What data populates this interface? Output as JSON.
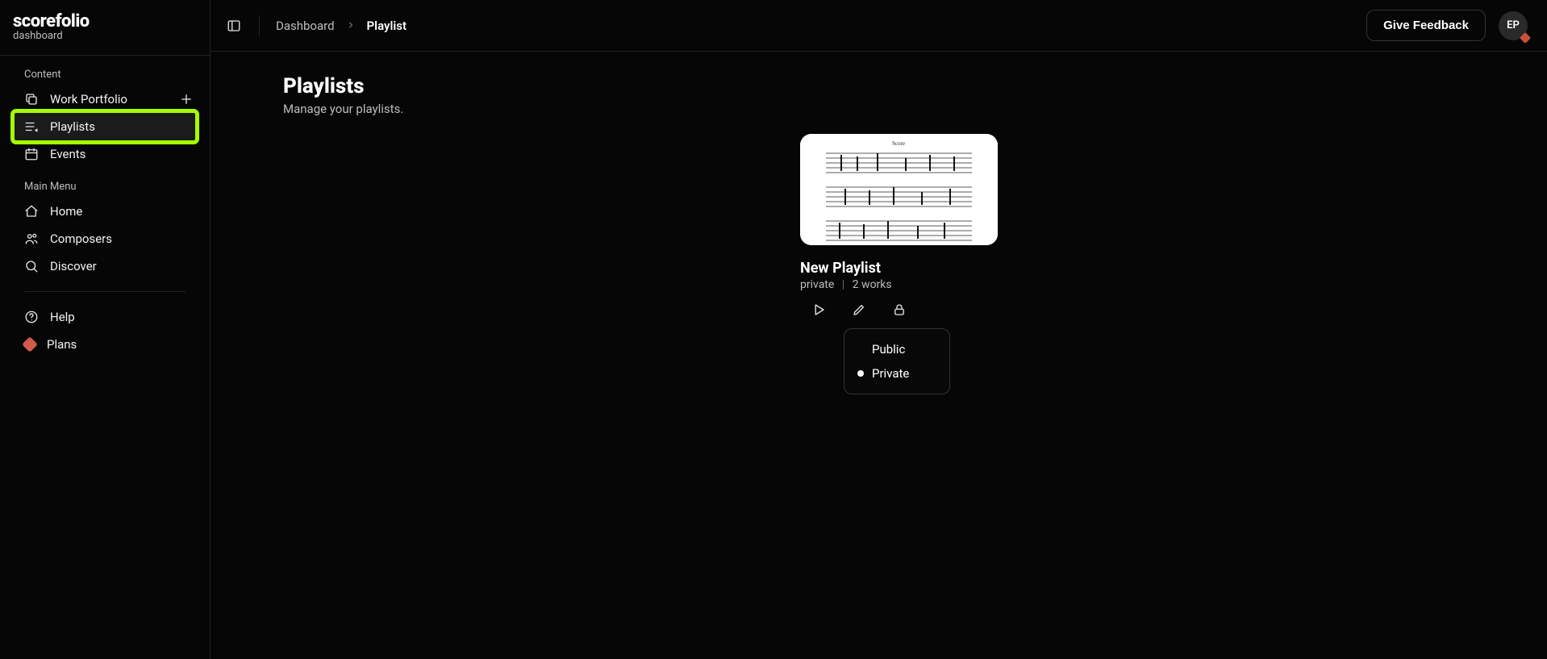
{
  "brand": {
    "name": "scorefolio",
    "sub": "dashboard"
  },
  "sidebar": {
    "sections": [
      {
        "label": "Content",
        "items": [
          {
            "label": "Work Portfolio",
            "icon": "copy-icon",
            "trailing_icon": "plus-icon"
          },
          {
            "label": "Playlists",
            "icon": "playlist-icon",
            "active": true,
            "highlighted": true
          },
          {
            "label": "Events",
            "icon": "calendar-icon"
          }
        ]
      },
      {
        "label": "Main Menu",
        "items": [
          {
            "label": "Home",
            "icon": "home-icon"
          },
          {
            "label": "Composers",
            "icon": "people-icon"
          },
          {
            "label": "Discover",
            "icon": "search-icon"
          }
        ]
      }
    ],
    "footer": [
      {
        "label": "Help",
        "icon": "help-icon"
      },
      {
        "label": "Plans",
        "icon": "plans-icon"
      }
    ]
  },
  "topbar": {
    "breadcrumbs": [
      {
        "label": "Dashboard",
        "current": false
      },
      {
        "label": "Playlist",
        "current": true
      }
    ],
    "feedback_label": "Give Feedback",
    "avatar_initials": "EP"
  },
  "page": {
    "title": "Playlists",
    "subtitle": "Manage your playlists."
  },
  "playlist_card": {
    "title": "New Playlist",
    "visibility": "private",
    "works_text": "2 works"
  },
  "visibility_popover": {
    "options": [
      {
        "label": "Public",
        "selected": false
      },
      {
        "label": "Private",
        "selected": true
      }
    ]
  }
}
